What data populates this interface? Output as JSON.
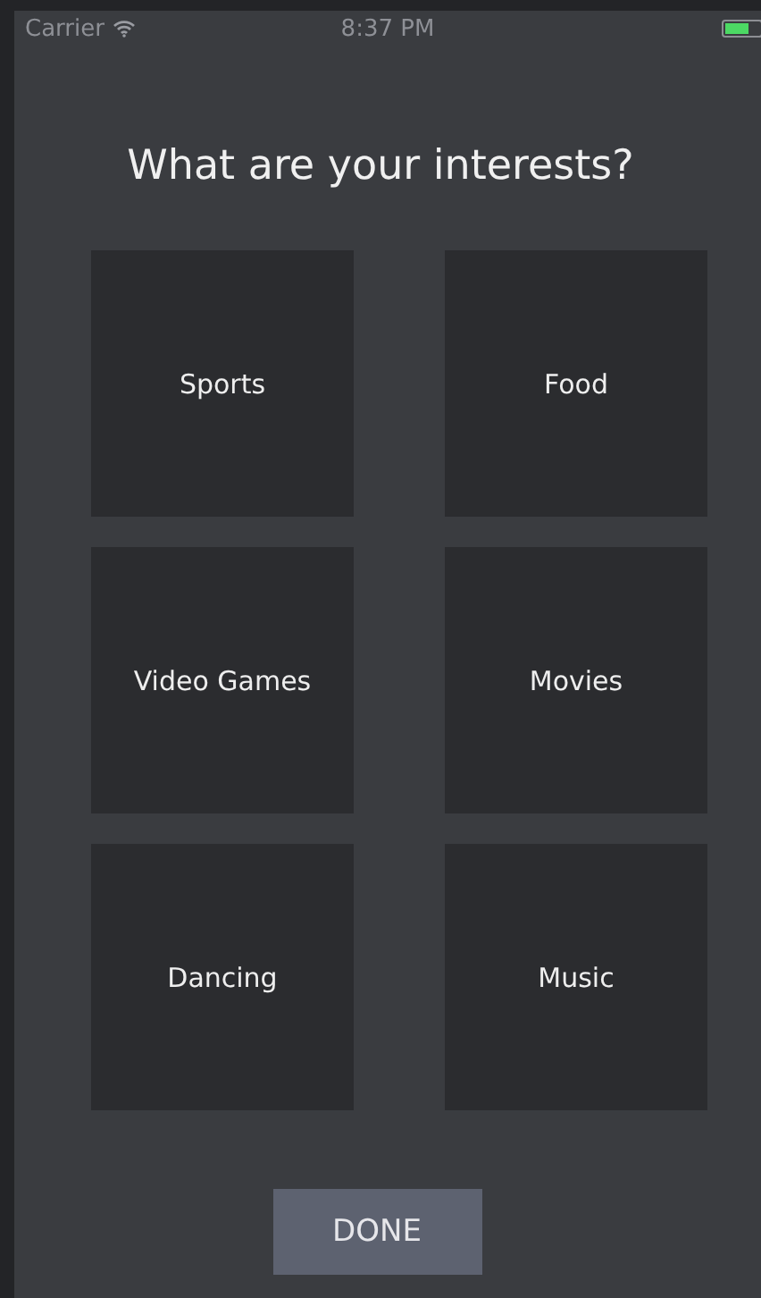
{
  "status_bar": {
    "carrier": "Carrier",
    "time": "8:37 PM"
  },
  "title": "What are your interests?",
  "interests": [
    {
      "label": "Sports"
    },
    {
      "label": "Food"
    },
    {
      "label": "Video Games"
    },
    {
      "label": "Movies"
    },
    {
      "label": "Dancing"
    },
    {
      "label": "Music"
    }
  ],
  "done_button": "DONE"
}
